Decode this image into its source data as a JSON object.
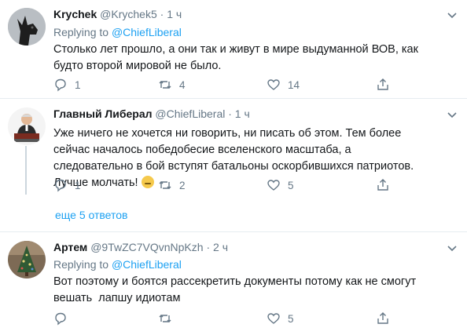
{
  "tweets": [
    {
      "name": "Krychek",
      "handle": "@Krychek5",
      "dot": "·",
      "time": "1 ч",
      "replying_prefix": "Replying to",
      "replying_to": "@ChiefLiberal",
      "text": "Столько лет прошло, а они так и живут в мире выдуманной ВОВ, как будто второй мировой не было.",
      "reply_count": "1",
      "retweet_count": "4",
      "like_count": "14",
      "avatar_icon": "dog-avatar"
    },
    {
      "name": "Главный Либерал",
      "handle": "@ChiefLiberal",
      "dot": "·",
      "time": "1 ч",
      "text": "Уже ничего не хочется ни говорить, ни писать об этом. Тем более сейчас началось победобесие вселенского масштаба, а следовательно в бой вступят батальоны оскорбившихся патриотов. Лучше молчать!",
      "emoji_icon": "zipper-mouth-face-icon",
      "reply_count": "1",
      "retweet_count": "2",
      "like_count": "5",
      "avatar_icon": "man-at-desk-avatar"
    },
    {
      "name": "Артем",
      "handle": "@9TwZC7VQvnNpKzh",
      "dot": "·",
      "time": "2 ч",
      "replying_prefix": "Replying to",
      "replying_to": "@ChiefLiberal",
      "text": "Вот поэтому и боятся рассекретить документы потому как не смогут вешать  лапшу идиотам",
      "reply_count": "",
      "retweet_count": "",
      "like_count": "5",
      "avatar_icon": "christmas-tree-avatar"
    }
  ],
  "more_replies": "еще 5 ответов",
  "colors": {
    "link": "#1da1f2",
    "muted": "#657786",
    "text": "#14171a",
    "separator": "#e6ecf0"
  }
}
